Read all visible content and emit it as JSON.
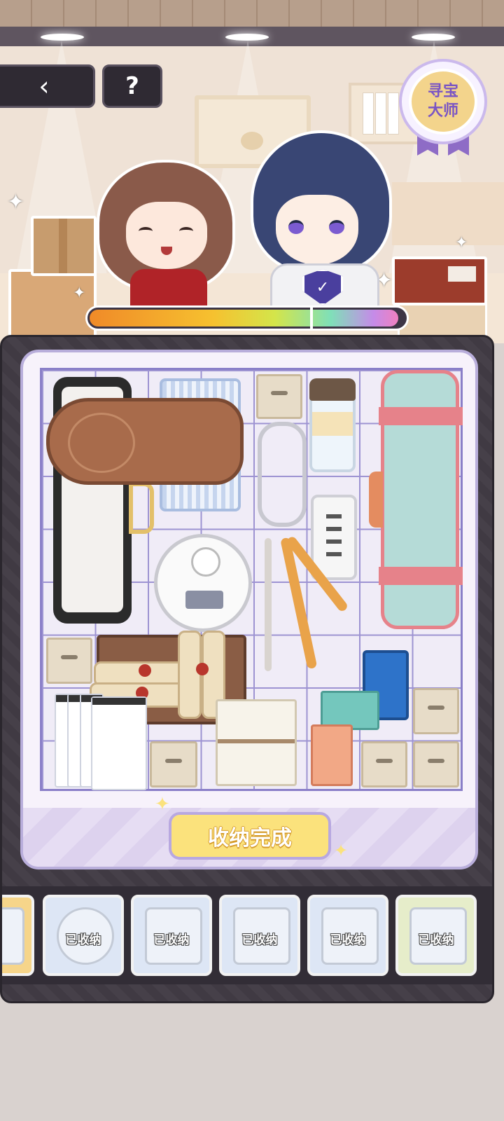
{
  "nav": {
    "back_icon": "‹",
    "help_label": "?"
  },
  "badge": {
    "line1": "寻宝",
    "line2": "大师"
  },
  "progress": {
    "value": 0.98,
    "marker": 0.7
  },
  "board": {
    "done_button": "收纳完成"
  },
  "tray": {
    "items": [
      {
        "item": "partial-box",
        "label": ""
      },
      {
        "item": "robot-vacuum",
        "label": "已收纳"
      },
      {
        "item": "cable-powerstrip",
        "label": "已收纳"
      },
      {
        "item": "books",
        "label": "已收纳"
      },
      {
        "item": "hanger",
        "label": "已收纳"
      },
      {
        "item": "cup",
        "label": "已收纳"
      }
    ]
  },
  "colors": {
    "accent": "#fbe27c",
    "panel": "#403a43",
    "grid_line": "#9d93d2",
    "border_purple": "#b9aedb"
  }
}
